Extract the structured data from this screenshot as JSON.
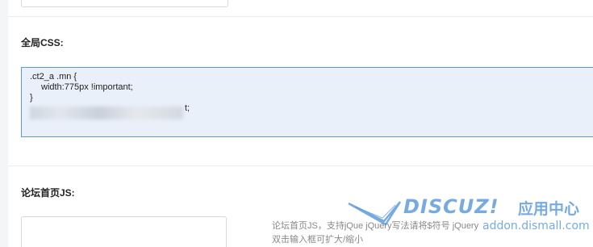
{
  "css_section": {
    "label": "全局CSS:",
    "code_line1": ".ct2_a .mn {",
    "code_line2": "width:775px !important;",
    "code_line3": "}",
    "code_line4_visible_tail": "t;"
  },
  "js_section": {
    "label": "论坛首页JS:",
    "hint_line1": "论坛首页JS，支持jQue   jQuery写法请将$符号   jQuery",
    "hint_line2": "双击输入框可扩大/缩小"
  },
  "watermark": {
    "brand": "DISCUZ!",
    "center": "应用中心",
    "url": "addon.dismall.com"
  },
  "colors": {
    "accent": "#5b9bd5",
    "textarea_bg": "#e9f0fa",
    "watermark": "#4a8fd6"
  }
}
